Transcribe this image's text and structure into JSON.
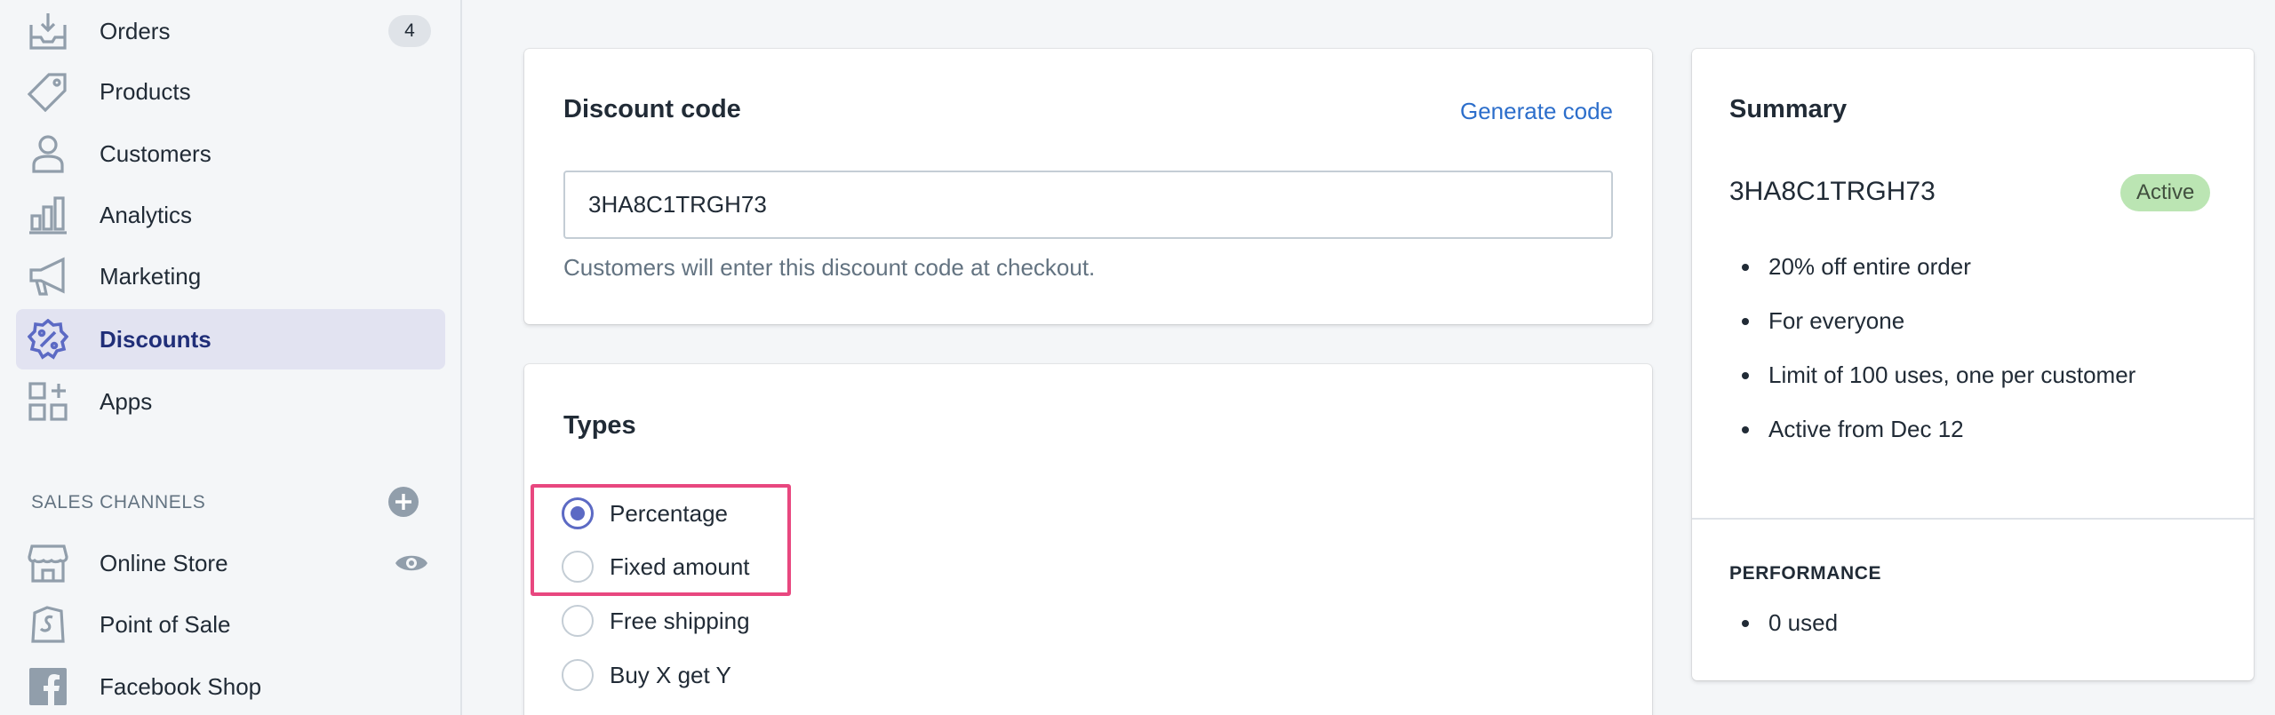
{
  "sidebar": {
    "items": [
      {
        "label": "Orders",
        "icon": "orders-icon",
        "badge": "4"
      },
      {
        "label": "Products",
        "icon": "tag-icon"
      },
      {
        "label": "Customers",
        "icon": "person-icon"
      },
      {
        "label": "Analytics",
        "icon": "bar-chart-icon"
      },
      {
        "label": "Marketing",
        "icon": "megaphone-icon"
      },
      {
        "label": "Discounts",
        "icon": "discount-icon",
        "active": true
      },
      {
        "label": "Apps",
        "icon": "apps-icon"
      }
    ],
    "sales_channels_label": "SALES CHANNELS",
    "channels": [
      {
        "label": "Online Store",
        "icon": "store-icon"
      },
      {
        "label": "Point of Sale",
        "icon": "pos-icon"
      },
      {
        "label": "Facebook Shop",
        "icon": "facebook-icon"
      }
    ]
  },
  "discount_code": {
    "title": "Discount code",
    "generate_label": "Generate code",
    "value": "3HA8C1TRGH73",
    "help": "Customers will enter this discount code at checkout."
  },
  "types": {
    "title": "Types",
    "options": [
      {
        "label": "Percentage",
        "checked": true
      },
      {
        "label": "Fixed amount",
        "checked": false
      },
      {
        "label": "Free shipping",
        "checked": false
      },
      {
        "label": "Buy X get Y",
        "checked": false
      }
    ]
  },
  "summary": {
    "title": "Summary",
    "code": "3HA8C1TRGH73",
    "status": "Active",
    "details": [
      "20% off entire order",
      "For everyone",
      "Limit of 100 uses, one per customer",
      "Active from Dec 12"
    ],
    "performance_label": "PERFORMANCE",
    "performance_items": [
      "0 used"
    ]
  },
  "colors": {
    "accent": "#5c6ac4",
    "active_nav_bg": "#e2e3f1",
    "link": "#2c6ecb",
    "success_badge": "#bbe5b3",
    "highlight": "#e8477f"
  }
}
